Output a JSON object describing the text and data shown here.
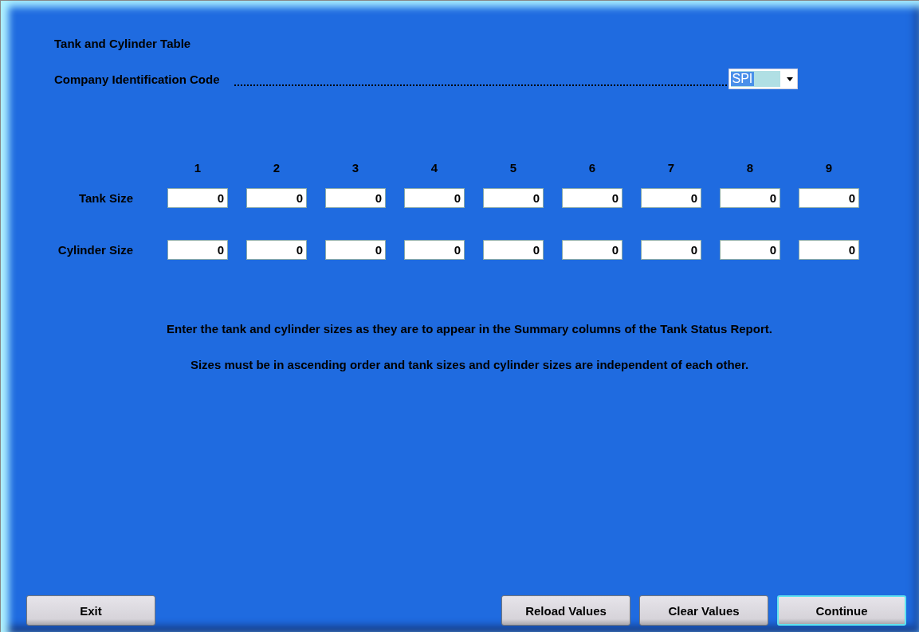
{
  "title": "Tank and Cylinder Table",
  "company_code": {
    "label": "Company Identification Code",
    "value": "SPI"
  },
  "columns": [
    "1",
    "2",
    "3",
    "4",
    "5",
    "6",
    "7",
    "8",
    "9"
  ],
  "rows": [
    {
      "label": "Tank Size",
      "values": [
        "0",
        "0",
        "0",
        "0",
        "0",
        "0",
        "0",
        "0",
        "0"
      ]
    },
    {
      "label": "Cylinder Size",
      "values": [
        "0",
        "0",
        "0",
        "0",
        "0",
        "0",
        "0",
        "0",
        "0"
      ]
    }
  ],
  "notes": [
    "Enter the tank and cylinder sizes as they are to appear in the Summary columns of the Tank Status Report.",
    "Sizes must be in ascending order and tank sizes and cylinder sizes are independent of each other."
  ],
  "buttons": [
    {
      "label": "Exit",
      "focused": false
    },
    {
      "label": "Reload Values",
      "focused": false
    },
    {
      "label": "Clear Values",
      "focused": false
    },
    {
      "label": "Continue",
      "focused": true
    }
  ]
}
